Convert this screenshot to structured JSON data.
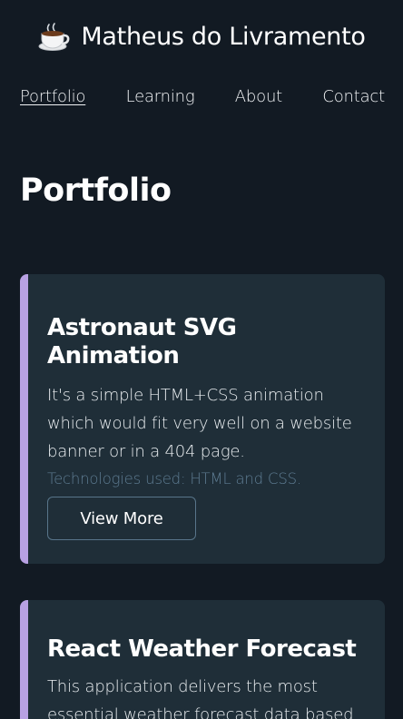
{
  "header": {
    "logo_icon": "coffee-cup-icon",
    "title": "Matheus do Livramento"
  },
  "nav": {
    "items": [
      {
        "label": "Portfolio",
        "active": true
      },
      {
        "label": "Learning"
      },
      {
        "label": "About"
      },
      {
        "label": "Contact"
      }
    ]
  },
  "main": {
    "title": "Portfolio",
    "projects": [
      {
        "title": "Astronaut SVG Animation",
        "description": "It's a simple HTML+CSS animation which would fit very well on a website banner or in a 404 page.",
        "technologies": "Technologies used: HTML and CSS.",
        "button_label": "View More"
      },
      {
        "title": "React Weather Forecast",
        "description": "This application delivers the most essential weather forecast data based"
      }
    ]
  },
  "colors": {
    "background": "#121a23",
    "card": "#1f2e38",
    "accent": "#b8a1e3",
    "muted_text": "#5e7c92"
  }
}
